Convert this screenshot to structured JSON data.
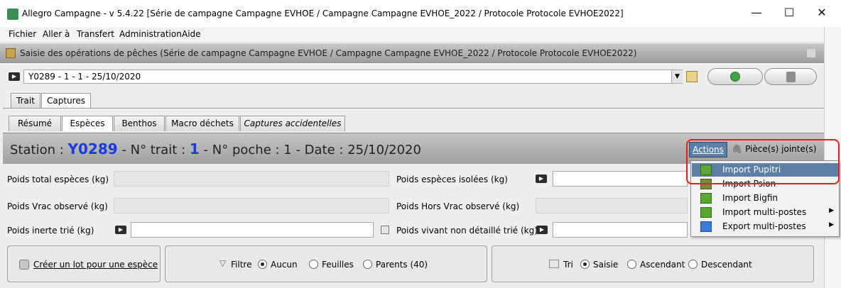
{
  "window": {
    "title": "Allegro Campagne - v 5.4.22 [Série de campagne Campagne EVHOE / Campagne Campagne EVHOE_2022 / Protocole Protocole EVHOE2022]",
    "minimize_glyph": "—",
    "maximize_glyph": "☐",
    "close_glyph": "✕"
  },
  "menubar": [
    "Fichier",
    "Aller à",
    "Transfert",
    "Administration",
    "Aide"
  ],
  "panel_header": "Saisie des opérations de pêches (Série de campagne Campagne EVHOE / Campagne Campagne EVHOE_2022 / Protocole Protocole EVHOE2022)",
  "operation_selector": {
    "value": "Y0289 - 1 - 1 - 25/10/2020"
  },
  "main_tabs": [
    "Trait",
    "Captures"
  ],
  "sub_tabs": [
    "Résumé",
    "Espèces",
    "Benthos",
    "Macro déchets",
    "Captures accidentelles"
  ],
  "station": {
    "label_station": "Station :",
    "station_id": "Y0289",
    "label_trait": "- N° trait :",
    "trait_no": "1",
    "rest": "- N° poche : 1 - Date : 25/10/2020"
  },
  "actions_label": "Actions",
  "pieces_label": "Pièce(s) jointe(s)",
  "fields": {
    "poids_total": "Poids total espèces (kg)",
    "poids_isolees": "Poids espèces isolées (kg)",
    "poids_vrac": "Poids Vrac observé (kg)",
    "poids_hors_vrac": "Poids Hors Vrac observé (kg)",
    "poids_inerte": "Poids inerte trié (kg)",
    "poids_vivant": "Poids vivant non détaillé trié (kg)"
  },
  "create_lot_label": "Créer un lot pour une espèce",
  "filter": {
    "label": "Filtre",
    "options": [
      "Aucun",
      "Feuilles",
      "Parents (40)"
    ]
  },
  "sort": {
    "label": "Tri",
    "options": [
      "Saisie",
      "Ascendant",
      "Descendant"
    ]
  },
  "actions_menu": [
    "Import Pupitri",
    "Import Psion",
    "Import Bigfin",
    "Import multi-postes",
    "Export multi-postes"
  ],
  "colors": {
    "accent": "#5b7fa6",
    "station_id": "#1b3be0",
    "highlight_box": "#e02020"
  }
}
